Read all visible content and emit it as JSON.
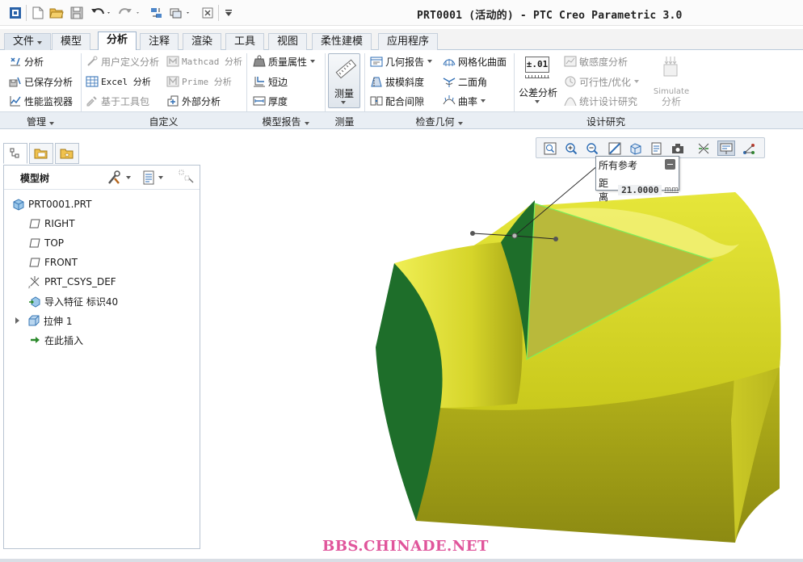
{
  "window": {
    "title": "PRT0001 (活动的) - PTC Creo Parametric 3.0"
  },
  "quick_access": [
    "app-icon",
    "new-icon",
    "open-icon",
    "save-icon",
    "undo-icon",
    "redo-icon",
    "regenerate-icon",
    "windows-icon",
    "close-window-icon",
    "customize-icon"
  ],
  "tabs": [
    {
      "label": "文件",
      "has_dropdown": true
    },
    {
      "label": "模型"
    },
    {
      "label": "分析",
      "active": true
    },
    {
      "label": "注释"
    },
    {
      "label": "渲染"
    },
    {
      "label": "工具"
    },
    {
      "label": "视图"
    },
    {
      "label": "柔性建模"
    },
    {
      "label": "应用程序"
    }
  ],
  "ribbon": {
    "manage": {
      "group_label": "管理",
      "items": [
        {
          "label": "分析",
          "icon": "analysis-icon"
        },
        {
          "label": "已保存分析",
          "icon": "saved-analysis-icon"
        },
        {
          "label": "性能监视器",
          "icon": "performance-monitor-icon"
        }
      ]
    },
    "custom": {
      "group_label": "自定义",
      "items": [
        {
          "label": "用户定义分析",
          "icon": "user-defined-analysis-icon",
          "disabled": true
        },
        {
          "label": "Excel 分析",
          "icon": "excel-icon"
        },
        {
          "label": "基于工具包",
          "icon": "toolkit-icon",
          "disabled": true
        },
        {
          "label": "Mathcad 分析",
          "icon": "mathcad-icon",
          "disabled": true
        },
        {
          "label": "Prime 分析",
          "icon": "prime-icon",
          "disabled": true
        },
        {
          "label": "外部分析",
          "icon": "external-analysis-icon"
        }
      ]
    },
    "model_report": {
      "group_label": "模型报告",
      "items": [
        {
          "label": "质量属性",
          "icon": "mass-properties-icon"
        },
        {
          "label": "短边",
          "icon": "short-edge-icon"
        },
        {
          "label": "厚度",
          "icon": "thickness-icon"
        }
      ]
    },
    "measure": {
      "group_label": "测量",
      "button_label": "测量",
      "icon": "ruler-icon"
    },
    "inspect": {
      "group_label": "检查几何",
      "items": [
        {
          "label": "几何报告",
          "icon": "geometry-report-icon"
        },
        {
          "label": "拔模斜度",
          "icon": "draft-icon"
        },
        {
          "label": "配合间隙",
          "icon": "clearance-icon"
        },
        {
          "label": "网格化曲面",
          "icon": "mesh-surface-icon"
        },
        {
          "label": "二面角",
          "icon": "dihedral-angle-icon"
        },
        {
          "label": "曲率",
          "icon": "curvature-icon"
        }
      ]
    },
    "design_study": {
      "group_label": "设计研究",
      "tolerance_badge": "±.01",
      "tolerance_label": "公差分析",
      "items": [
        {
          "label": "敏感度分析",
          "icon": "sensitivity-icon",
          "disabled": true
        },
        {
          "label": "可行性/优化",
          "icon": "feasibility-icon",
          "disabled": true
        },
        {
          "label": "统计设计研究",
          "icon": "statistical-icon",
          "disabled": true
        }
      ],
      "simulate_line1": "Simulate",
      "simulate_line2": "分析"
    }
  },
  "model_tree": {
    "title": "模型树",
    "items": [
      {
        "label": "PRT0001.PRT",
        "icon": "part-icon"
      },
      {
        "label": "RIGHT",
        "icon": "datum-plane-icon"
      },
      {
        "label": "TOP",
        "icon": "datum-plane-icon"
      },
      {
        "label": "FRONT",
        "icon": "datum-plane-icon"
      },
      {
        "label": "PRT_CSYS_DEF",
        "icon": "csys-icon"
      },
      {
        "label": "导入特征 标识40",
        "icon": "import-feature-icon"
      },
      {
        "label": "拉伸 1",
        "icon": "extrude-icon",
        "expandable": true
      },
      {
        "label": "在此插入",
        "icon": "insert-here-icon"
      }
    ]
  },
  "measure_callout": {
    "title": "所有参考",
    "label": "距离",
    "value": "21.0000",
    "unit": "mm"
  },
  "watermark": "BBS.CHINADE.NET",
  "colors": {
    "model_yellow": "#d8d820",
    "model_green": "#1e6e2a",
    "selection_highlight": "#7cf05a",
    "accent_blue": "#2e6db4"
  }
}
